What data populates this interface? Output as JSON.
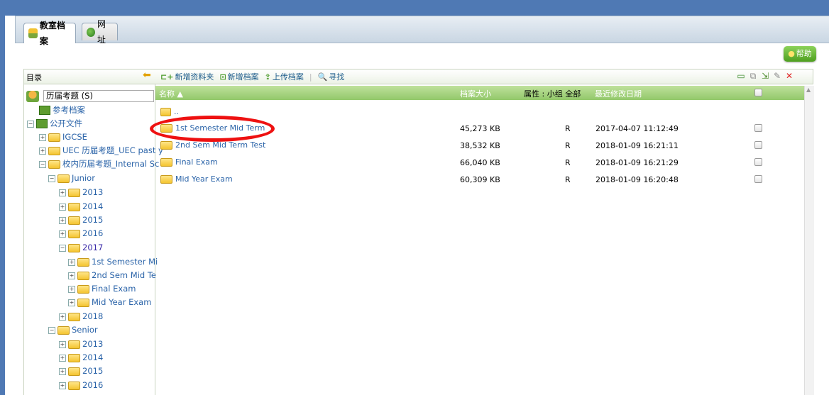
{
  "tabs": [
    {
      "label": "教室档案",
      "icon": "people-icon",
      "active": true
    },
    {
      "label": "网址",
      "icon": "globe-icon",
      "active": false
    }
  ],
  "help_label": "帮助",
  "panel": {
    "dir_label": "目录"
  },
  "toolbar": {
    "new_folder": "新增资料夹",
    "new_file": "新增档案",
    "upload": "上传档案",
    "search": "寻找"
  },
  "tree": {
    "root_input": "历届考题 (S)",
    "items": [
      {
        "label": "参考档案"
      },
      {
        "label": "公开文件"
      },
      {
        "label": "IGCSE"
      },
      {
        "label": "UEC 历届考题_UEC past y"
      },
      {
        "label": "校内历届考题_Internal Sc"
      },
      {
        "label": "Junior"
      },
      {
        "label": "2013"
      },
      {
        "label": "2014"
      },
      {
        "label": "2015"
      },
      {
        "label": "2016"
      },
      {
        "label": "2017"
      },
      {
        "label": "1st Semester Mi"
      },
      {
        "label": "2nd Sem Mid Te"
      },
      {
        "label": "Final Exam"
      },
      {
        "label": "Mid Year Exam"
      },
      {
        "label": "2018"
      },
      {
        "label": "Senior"
      },
      {
        "label": "2013"
      },
      {
        "label": "2014"
      },
      {
        "label": "2015"
      },
      {
        "label": "2016"
      }
    ]
  },
  "columns": {
    "name": "名称",
    "size": "档案大小",
    "attr": "属性 : 小组 全部",
    "modified": "最近修改日期"
  },
  "files": [
    {
      "name": "1st Semester Mid Term",
      "size": "45,273 KB",
      "attr": "R",
      "date": "2017-04-07 11:12:49"
    },
    {
      "name": "2nd Sem Mid Term Test",
      "size": "38,532 KB",
      "attr": "R",
      "date": "2018-01-09 16:21:11"
    },
    {
      "name": "Final Exam",
      "size": "66,040 KB",
      "attr": "R",
      "date": "2018-01-09 16:21:29"
    },
    {
      "name": "Mid Year Exam",
      "size": "60,309 KB",
      "attr": "R",
      "date": "2018-01-09 16:20:48"
    }
  ],
  "colors": {
    "header_green": "#92c86a",
    "frame_blue": "#4f79b4",
    "link_blue": "#2a63a8",
    "annotation_red": "#ee1111"
  }
}
